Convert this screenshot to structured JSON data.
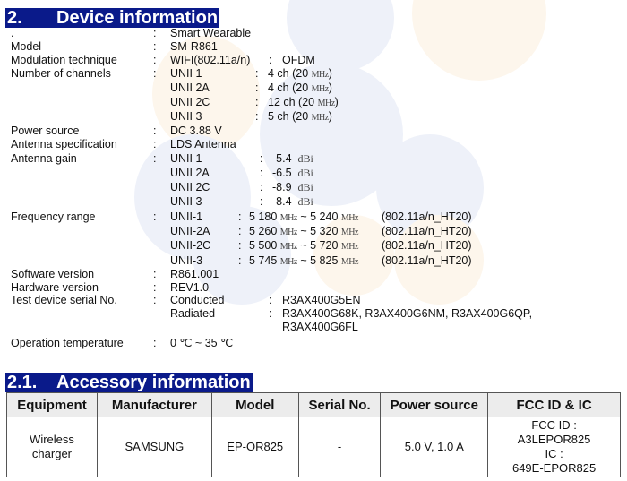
{
  "section_2": {
    "number": "2.",
    "title": "Device information",
    "fields": {
      "product": {
        "label": ".",
        "value": "Smart Wearable"
      },
      "model": {
        "label": "Model",
        "value": "SM-R861"
      },
      "modulation": {
        "label": "Modulation technique",
        "value": "WIFI(802.11a/n)",
        "sub_value": "OFDM"
      },
      "channels": {
        "label": "Number of channels",
        "items": [
          {
            "band": "UNII 1",
            "count": "4 ch (20",
            "unit": "MHz",
            "close": ")"
          },
          {
            "band": "UNII 2A",
            "count": "4 ch (20",
            "unit": "MHz",
            "close": ")"
          },
          {
            "band": "UNII 2C",
            "count": "12 ch (20",
            "unit": "MHz",
            "close": ")"
          },
          {
            "band": "UNII 3",
            "count": "5 ch (20",
            "unit": "MHz",
            "close": ")"
          }
        ]
      },
      "power_source": {
        "label": "Power source",
        "value": "DC 3.88 V"
      },
      "antenna_spec": {
        "label": "Antenna specification",
        "value": "LDS Antenna"
      },
      "antenna_gain": {
        "label": "Antenna gain",
        "items": [
          {
            "band": "UNII 1",
            "value": "-5.4",
            "unit": "dBi"
          },
          {
            "band": "UNII 2A",
            "value": "-6.5",
            "unit": "dBi"
          },
          {
            "band": "UNII 2C",
            "value": "-8.9",
            "unit": "dBi"
          },
          {
            "band": "UNII 3",
            "value": "-8.4",
            "unit": "dBi"
          }
        ]
      },
      "frequency_range": {
        "label": "Frequency range",
        "items": [
          {
            "band": "UNII-1",
            "low": "5 180",
            "high": "5 240",
            "unit": "MHz",
            "mode": "(802.11a/n_HT20)"
          },
          {
            "band": "UNII-2A",
            "low": "5 260",
            "high": "5 320",
            "unit": "MHz",
            "mode": "(802.11a/n_HT20)"
          },
          {
            "band": "UNII-2C",
            "low": "5 500",
            "high": "5 720",
            "unit": "MHz",
            "mode": "(802.11a/n_HT20)"
          },
          {
            "band": "UNII-3",
            "low": "5 745",
            "high": "5 825",
            "unit": "MHz",
            "mode": "(802.11a/n_HT20)"
          }
        ]
      },
      "software_version": {
        "label": "Software version",
        "value": "R861.001"
      },
      "hardware_version": {
        "label": "Hardware version",
        "value": "REV1.0"
      },
      "serial": {
        "label": "Test device serial No.",
        "conducted_label": "Conducted",
        "conducted_value": "R3AX400G5EN",
        "radiated_label": "Radiated",
        "radiated_value_line1": "R3AX400G68K, R3AX400G6NM, R3AX400G6QP,",
        "radiated_value_line2": "R3AX400G6FL"
      },
      "operation_temperature": {
        "label": "Operation temperature",
        "value": "0 ℃ ~ 35 ℃"
      }
    },
    "separator": ":",
    "range_separator": "~"
  },
  "section_2_1": {
    "number": "2.1.",
    "title": "Accessory information",
    "table": {
      "headers": [
        "Equipment",
        "Manufacturer",
        "Model",
        "Serial No.",
        "Power source",
        "FCC ID & IC"
      ],
      "rows": [
        {
          "equipment_line1": "Wireless",
          "equipment_line2": "charger",
          "manufacturer": "SAMSUNG",
          "model": "EP-OR825",
          "serial": "-",
          "power_source": "5.0 V, 1.0 A",
          "fcc_label": "FCC ID :",
          "fcc_id": "A3LEPOR825",
          "ic_label": "IC :",
          "ic_id": "649E-EPOR825"
        }
      ]
    }
  },
  "colors": {
    "heading_bg": "#0a1a8a",
    "heading_text": "#ffffff",
    "table_header_bg": "#ececec"
  }
}
